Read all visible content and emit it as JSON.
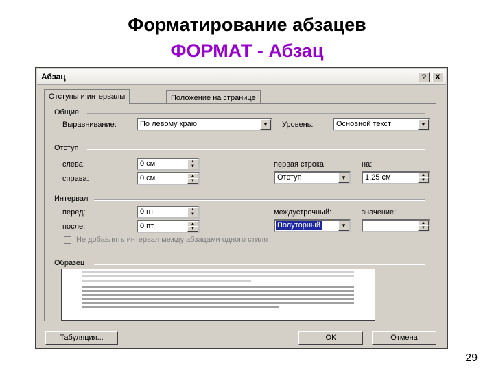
{
  "slide": {
    "title": "Форматирование абзацев",
    "subtitle": "ФОРМАТ - Абзац",
    "page_number": "29"
  },
  "dialog": {
    "title": "Абзац",
    "help_button": "?",
    "close_button": "X",
    "tabs": [
      "Отступы и интервалы",
      "Положение на странице"
    ],
    "general": {
      "section": "Общие",
      "alignment_label": "Выравнивание:",
      "alignment_value": "По левому краю",
      "level_label": "Уровень:",
      "level_value": "Основной текст"
    },
    "indent": {
      "section": "Отступ",
      "left_label": "слева:",
      "left_value": "0 см",
      "right_label": "справа:",
      "right_value": "0 см",
      "first_line_label": "первая строка:",
      "first_line_value": "Отступ",
      "by_label": "на:",
      "by_value": "1,25 см"
    },
    "spacing": {
      "section": "Интервал",
      "before_label": "перед:",
      "before_value": "0 пт",
      "after_label": "после:",
      "after_value": "0 пт",
      "line_spacing_label": "междустрочный:",
      "line_spacing_value": "Полуторный",
      "value_label": "значение:",
      "value_value": "",
      "no_space_checkbox": "Не добавлять интервал между абзацами одного стиля"
    },
    "preview": {
      "section": "Образец"
    },
    "buttons": {
      "tabs": "Табуляция...",
      "ok": "ОК",
      "cancel": "Отмена"
    }
  },
  "colors": {
    "subtitle": "#9900cc",
    "dialog_bg": "#d4d0c8",
    "selection": "#1e28a0"
  }
}
